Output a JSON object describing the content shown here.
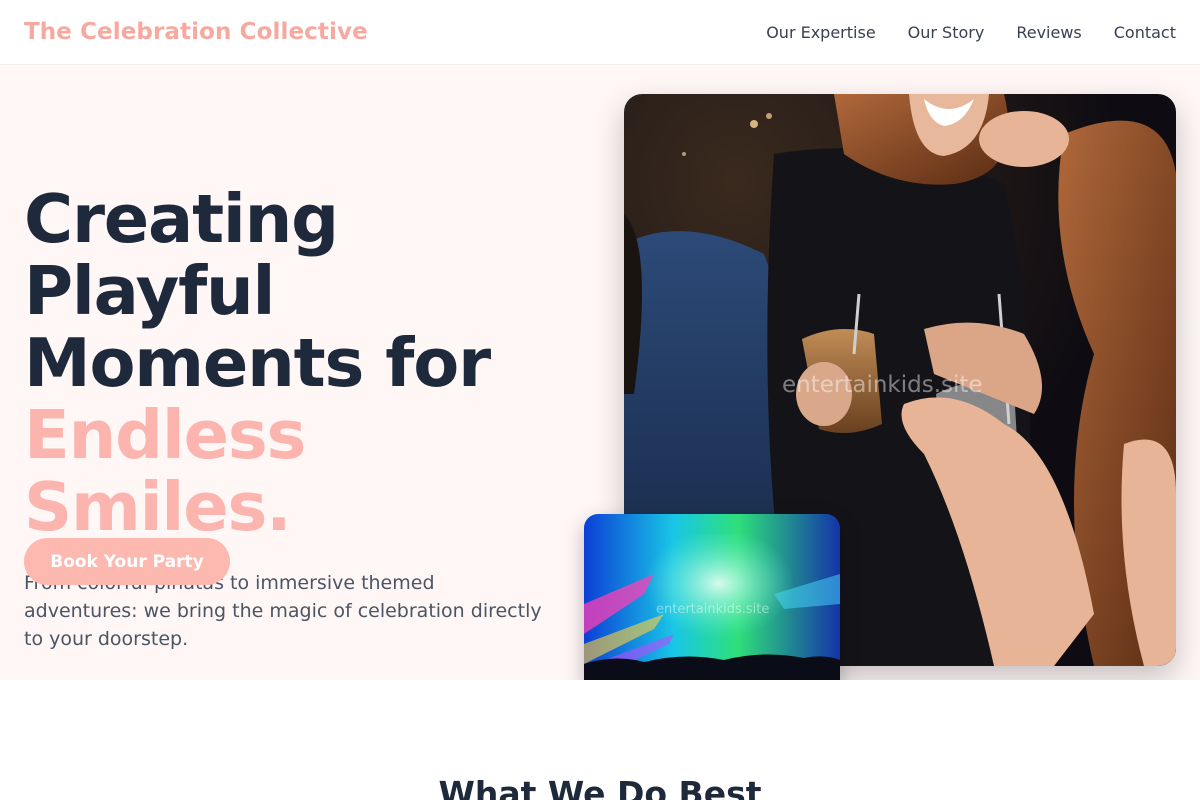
{
  "header": {
    "brand": "The Celebration Collective",
    "nav": [
      {
        "label": "Our Expertise"
      },
      {
        "label": "Our Story"
      },
      {
        "label": "Reviews"
      },
      {
        "label": "Contact"
      }
    ]
  },
  "hero": {
    "title_line1": "Creating Playful",
    "title_line2": "Moments for",
    "title_accent": "Endless Smiles.",
    "subtitle": "From colorful piñatas to immersive themed adventures: we bring the magic of celebration directly to your doorstep.",
    "cta_label": "Book Your Party",
    "watermark_main": "entertainkids.site",
    "watermark_small": "entertainkids.site"
  },
  "section": {
    "title": "What We Do Best"
  },
  "colors": {
    "accent": "#fbb5ae",
    "brand": "#f7a9a0",
    "hero_bg": "#fff6f6",
    "heading": "#1e293b"
  },
  "icons": {
    "main_image": "party-friends-drinks-image",
    "small_image": "concert-lights-image"
  }
}
